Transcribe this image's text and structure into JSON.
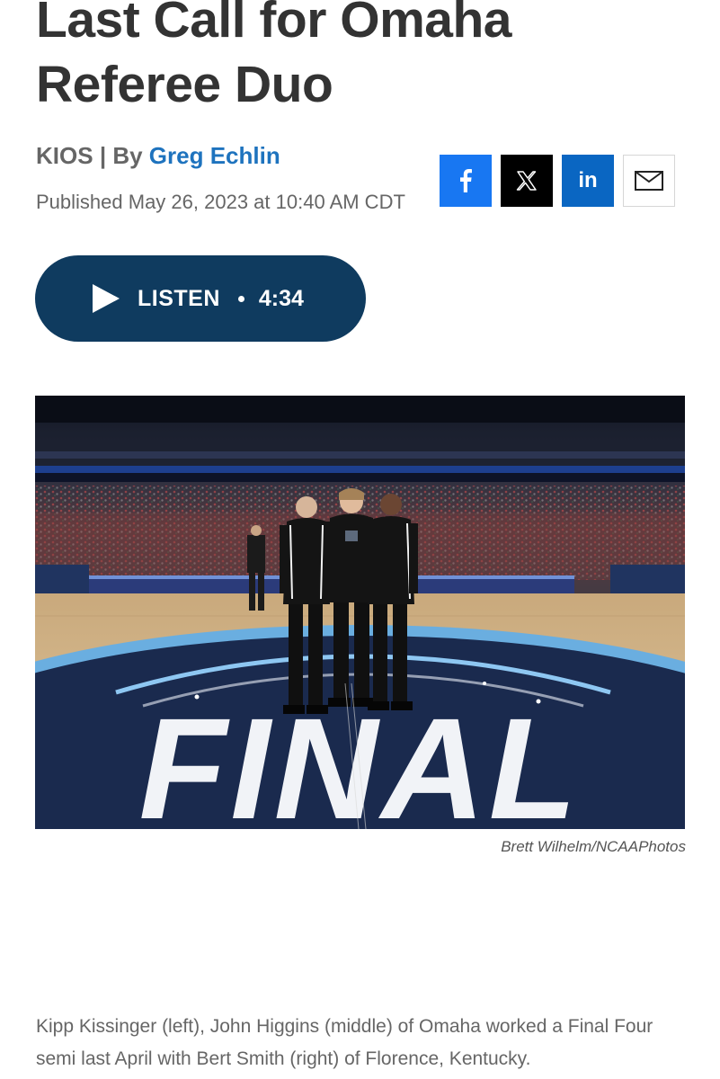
{
  "article": {
    "headline": "Last Call for Omaha Referee Duo",
    "source": "KIOS",
    "by_prefix": "By",
    "author": "Greg Echlin",
    "published": "Published May 26, 2023 at 10:40 AM CDT"
  },
  "share": {
    "facebook_icon": "facebook-icon",
    "x_icon": "x-icon",
    "linkedin_icon": "linkedin-icon",
    "linkedin_label": "in",
    "email_icon": "email-icon",
    "colors": {
      "facebook": "#1877f2",
      "x": "#000000",
      "linkedin": "#0a66c2"
    }
  },
  "audio": {
    "label": "LISTEN",
    "duration": "4:34",
    "icon": "play-icon",
    "background": "#0f3b5f"
  },
  "photo": {
    "alt": "Three referees standing at center court on the Final Four logo",
    "court_text": "FINAL",
    "credit": "Brett Wilhelm/NCAAPhotos"
  },
  "caption": "Kipp Kissinger (left), John Higgins (middle) of Omaha worked a Final Four semi last April with Bert Smith (right) of Florence, Kentucky."
}
